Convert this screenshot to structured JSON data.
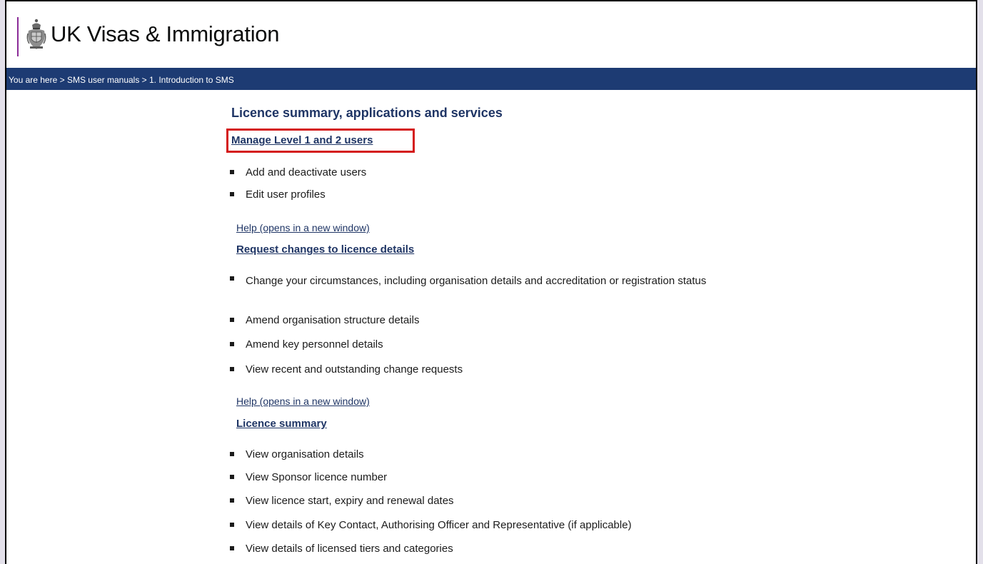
{
  "header": {
    "site_title": "UK Visas & Immigration",
    "brand_color": "#8a2b97",
    "crest_icon": "royal-crest-icon"
  },
  "breadcrumb": {
    "text": "You are here > SMS user manuals > 1. Introduction to SMS",
    "background_color": "#1d3b73"
  },
  "main": {
    "title": "Licence summary, applications and services",
    "sections": [
      {
        "heading_link": "Manage Level 1 and 2 users",
        "highlighted": true,
        "items": [
          "Add and deactivate users",
          "Edit user profiles"
        ],
        "help_link": "Help (opens in a new window)"
      },
      {
        "heading_link": "Request changes to licence details",
        "items": [
          "Change your circumstances, including organisation details and accreditation or registration status",
          "Amend organisation structure details",
          "Amend key personnel details",
          "View recent and outstanding change requests"
        ],
        "help_link": "Help (opens in a new window)"
      },
      {
        "heading_link": "Licence summary",
        "items": [
          "View organisation details",
          "View Sponsor licence number",
          "View licence start, expiry and renewal dates",
          "View details of Key Contact, Authorising Officer and Representative (if applicable)",
          "View details of licensed tiers and categories"
        ]
      }
    ]
  },
  "colors": {
    "link": "#1f3565",
    "highlight": "#d41a1a"
  }
}
